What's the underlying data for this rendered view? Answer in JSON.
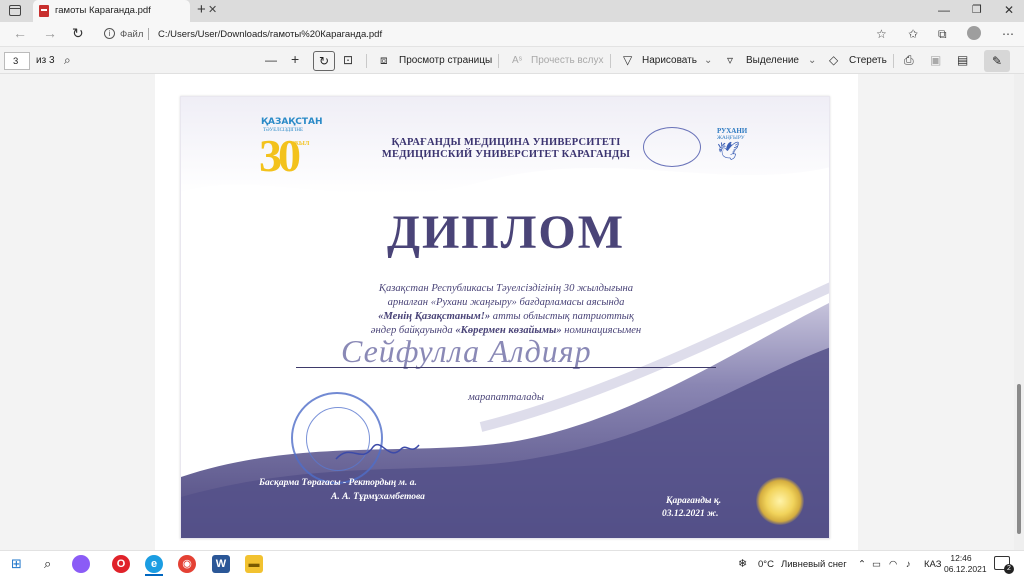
{
  "tab": {
    "title": "гамоты Караганда.pdf"
  },
  "address": {
    "protocol_label": "Файл",
    "url": "C:/Users/User/Downloads/гамоты%20Караганда.pdf"
  },
  "pdf_toolbar": {
    "page_current": "3",
    "page_total": "из 3",
    "page_view": "Просмотр страницы",
    "read_aloud": "Прочесть вслух",
    "draw": "Нарисовать",
    "highlight": "Выделение",
    "erase": "Стереть"
  },
  "diploma": {
    "logo_left_line1": "ҚАЗАҚСТАН",
    "logo_left_line2": "ТӘУЕЛСІЗДІГІНЕ",
    "logo_left_number": "30",
    "logo_left_suffix": "ЖЫЛ",
    "university_kz": "ҚАРАҒАНДЫ МЕДИЦИНА УНИВЕРСИТЕТІ",
    "university_ru": "МЕДИЦИНСКИЙ УНИВЕРСИТЕТ КАРАГАНДЫ",
    "logo_right_line1": "РУХАНИ",
    "logo_right_line2": "ЖАҢҒЫРУ",
    "title": "ДИПЛОМ",
    "text_line1": "Қазақстан Республикасы Тәуелсіздігінің 30 жылдығына",
    "text_line2": "арналған «Рухани жаңғыру» бағдарламасы аясында",
    "text_line3_bold": "«Менің Қазақстаным!»",
    "text_line3_rest": " атты облыстық патриоттық",
    "text_line4_start": "әндер байқауында ",
    "text_line4_bold": "«Көрермен көзайымы»",
    "text_line4_rest": " номинациясымен",
    "recipient": "Сейфулла Алдияр",
    "awarded": "марапатталады",
    "signer_title": "Басқарма Төрағасы - Ректордың м. а.",
    "signer_name": "А. А. Тұрмұхамбетова",
    "city": "Қарағанды қ.",
    "date": "03.12.2021 ж."
  },
  "taskbar": {
    "temperature": "0°C",
    "weather": "Ливневый снег",
    "language": "КАЗ",
    "time": "12:46",
    "date": "06.12.2021",
    "notifications": "2"
  },
  "colors": {
    "accent": "#0067c0",
    "diploma_purple": "#4a4478",
    "diploma_band": "#54508a"
  }
}
